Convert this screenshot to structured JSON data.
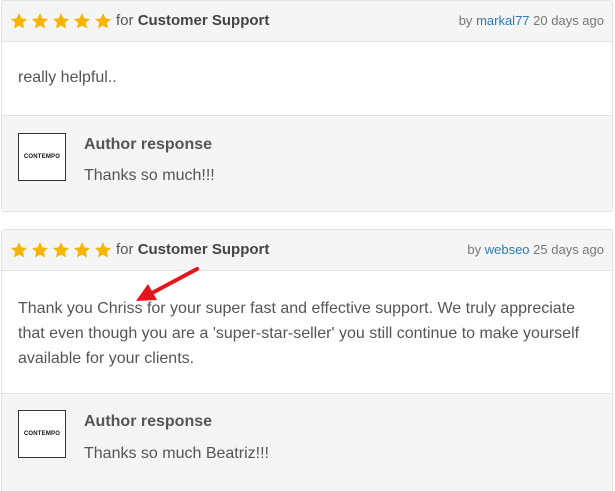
{
  "reviews": [
    {
      "stars": 5,
      "for_prefix": "for",
      "category": "Customer Support",
      "by_prefix": "by",
      "user": "markal77",
      "time": "20 days ago",
      "body": "really helpful..",
      "response": {
        "logo_text": "CONTEMPO",
        "title": "Author response",
        "text": "Thanks so much!!!"
      }
    },
    {
      "stars": 5,
      "for_prefix": "for",
      "category": "Customer Support",
      "by_prefix": "by",
      "user": "webseo",
      "time": "25 days ago",
      "body_lines": [
        "Thank you Chriss for your super fast and effective support. We truly appreciate",
        "that even though you are a 'super-star-seller' you still continue to make yourself",
        "available for your clients."
      ],
      "response": {
        "logo_text": "CONTEMPO",
        "title": "Author response",
        "text": "Thanks so much Beatriz!!!"
      }
    }
  ],
  "colors": {
    "star": "#f7b500",
    "username": "#2b7bb9",
    "arrow": "#e8141b"
  },
  "icons": {
    "star": "star-icon",
    "arrow": "red-arrow-annotation"
  }
}
